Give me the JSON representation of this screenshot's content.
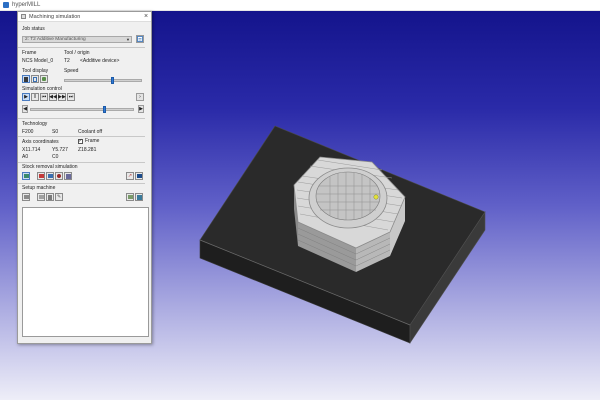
{
  "app": {
    "title": "hyperMILL"
  },
  "panel": {
    "title": "Machining simulation",
    "close_glyph": "×",
    "job_status_label": "Job status",
    "job_status_value": "2: T2 Additive Manufacturing",
    "frame_label": "Frame",
    "frame_value": "NCS Model_0",
    "tool_origin_label": "Tool / origin",
    "tool_value": "T2",
    "origin_value": "<Additive device>",
    "tool_display_label": "Tool display",
    "speed_label": "Speed",
    "speed_level": 0.62,
    "simulation_control_label": "Simulation control",
    "progress_level": 0.72,
    "technology_label": "Technology",
    "feed_value": "F200",
    "spindle_value": "S0",
    "coolant_value": "Coolant off",
    "axis_coordinates_label": "Axis coordinates",
    "frame_checkbox_label": "Frame",
    "frame_checked": true,
    "x_value": "X11.714",
    "y_value": "Y5.727",
    "z_value": "Z18.281",
    "a_value": "A0",
    "c_value": "C0",
    "stock_removal_label": "Stock removal simulation",
    "setup_machine_label": "Setup machine"
  },
  "colors": {
    "accent": "#2f7ad6",
    "background_top": "#14148c",
    "background_bottom": "#eeeef8"
  }
}
